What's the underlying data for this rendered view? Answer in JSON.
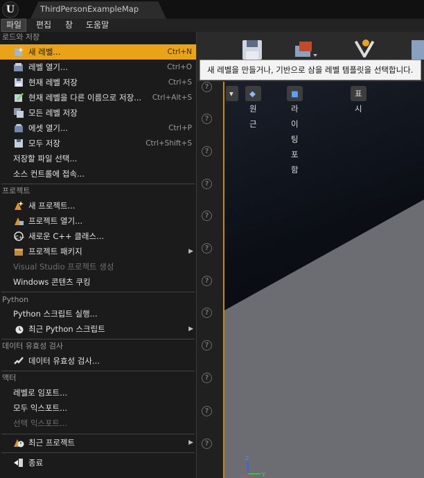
{
  "window": {
    "tab_title": "ThirdPersonExampleMap"
  },
  "menubar": {
    "items": [
      "파일",
      "편집",
      "창",
      "도움말"
    ]
  },
  "tooltip": "새 레벨을 만들거나, 기반으로 삼을 레벨 템플릿을 선택합니다.",
  "viewport": {
    "buttons": [
      "원근",
      "라이팅포함",
      "표시"
    ],
    "axis": {
      "z": "Z",
      "y": "Y"
    }
  },
  "menu": {
    "sections": [
      "로드와 저장",
      "프로젝트",
      "Python",
      "데이터 유효성 검사",
      "액터"
    ],
    "load_save": [
      {
        "label": "새 레벨...",
        "shortcut": "Ctrl+N",
        "icon": "new-level-icon",
        "highlighted": true
      },
      {
        "label": "레벨 열기...",
        "shortcut": "Ctrl+O",
        "icon": "open-level-icon"
      },
      {
        "label": "현재 레벨 저장",
        "shortcut": "Ctrl+S",
        "icon": "save-icon"
      },
      {
        "label": "현재 레벨을 다른 이름으로 저장...",
        "shortcut": "Ctrl+Alt+S",
        "icon": "save-as-icon"
      },
      {
        "label": "모든 레벨 저장",
        "shortcut": "",
        "icon": "save-all-levels-icon"
      },
      {
        "label": "에셋 열기...",
        "shortcut": "Ctrl+P",
        "icon": "open-asset-icon"
      },
      {
        "label": "모두 저장",
        "shortcut": "Ctrl+Shift+S",
        "icon": "save-all-icon"
      },
      {
        "label": "저장할 파일 선택...",
        "shortcut": ""
      },
      {
        "label": "소스 컨트롤에 접속...",
        "shortcut": ""
      }
    ],
    "project": [
      {
        "label": "새 프로젝트...",
        "icon": "new-project-icon"
      },
      {
        "label": "프로젝트 열기...",
        "icon": "open-project-icon"
      },
      {
        "label": "새로운 C++ 클래스...",
        "icon": "cpp-class-icon"
      },
      {
        "label": "프로젝트 패키지",
        "icon": "package-icon",
        "submenu": true
      },
      {
        "label": "Visual Studio 프로젝트 생성",
        "disabled": true
      },
      {
        "label": "Windows 콘텐츠 쿠킹"
      }
    ],
    "python": [
      {
        "label": "Python 스크립트 실행..."
      },
      {
        "label": "최근 Python 스크립트",
        "icon": "recent-icon",
        "submenu": true
      }
    ],
    "validation": [
      {
        "label": "데이터 유효성 검사...",
        "icon": "validation-icon"
      }
    ],
    "actor": [
      {
        "label": "레벨로 임포트..."
      },
      {
        "label": "모두 익스포트..."
      },
      {
        "label": "선택 익스포트...",
        "disabled": true
      }
    ],
    "recent_projects": {
      "label": "최근 프로젝트",
      "icon": "recent-projects-icon",
      "submenu": true
    },
    "exit": {
      "label": "종료",
      "icon": "exit-icon"
    }
  },
  "colors": {
    "highlight": "#e8a416",
    "menu_bg": "#1b1b1b",
    "viewport_border": "#c88a12"
  }
}
